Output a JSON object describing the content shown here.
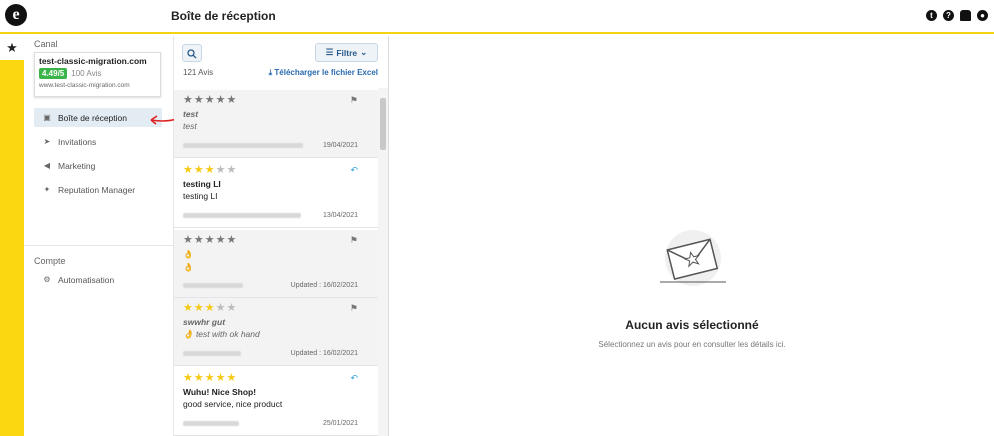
{
  "header": {
    "title": "Boîte de réception",
    "icons": [
      "t-icon",
      "help-icon",
      "bell-icon",
      "user-icon"
    ]
  },
  "sidebar": {
    "section_canal": "Canal",
    "card": {
      "name": "test-classic-migration.com",
      "rating": "4.49/5",
      "count": "100 Avis",
      "url": "www.test-classic-migration.com"
    },
    "items": [
      {
        "label": "Boîte de réception",
        "icon": "inbox-icon"
      },
      {
        "label": "Invitations",
        "icon": "send-icon"
      },
      {
        "label": "Marketing",
        "icon": "megaphone-icon"
      },
      {
        "label": "Reputation Manager",
        "icon": "sparkle-icon"
      }
    ],
    "section_compte": "Compte",
    "account_items": [
      {
        "label": "Automatisation",
        "icon": "gear-icon"
      }
    ]
  },
  "list": {
    "filter_label": "Filtre",
    "count": "121 Avis",
    "download_label": "Télécharger le fichier Excel",
    "reviews": [
      {
        "stars": 0,
        "title": "test",
        "body": "test",
        "date": "19/04/2021",
        "action": "flag-icon",
        "muted": true
      },
      {
        "stars": 3,
        "title": "testing LI",
        "body": "testing LI",
        "date": "13/04/2021",
        "action": "reply-icon",
        "muted": false
      },
      {
        "stars": 0,
        "title": "👌",
        "body": "👌",
        "date": "Updated : 16/02/2021",
        "action": "flag-icon",
        "muted": false
      },
      {
        "stars": 3,
        "title": "swwhr gut",
        "body": "👌 test with ok hand",
        "date": "Updated : 16/02/2021",
        "action": "flag-icon",
        "muted": true
      },
      {
        "stars": 5,
        "title": "Wuhu! Nice Shop!",
        "body": "good service, nice product",
        "date": "25/01/2021",
        "action": "reply-icon",
        "muted": false
      }
    ]
  },
  "empty_state": {
    "title": "Aucun avis sélectionné",
    "subtitle": "Sélectionnez un avis pour en consulter les détails ici."
  },
  "colors": {
    "accent": "#fad711",
    "badge": "#3bb54a",
    "link": "#2a6aad"
  }
}
